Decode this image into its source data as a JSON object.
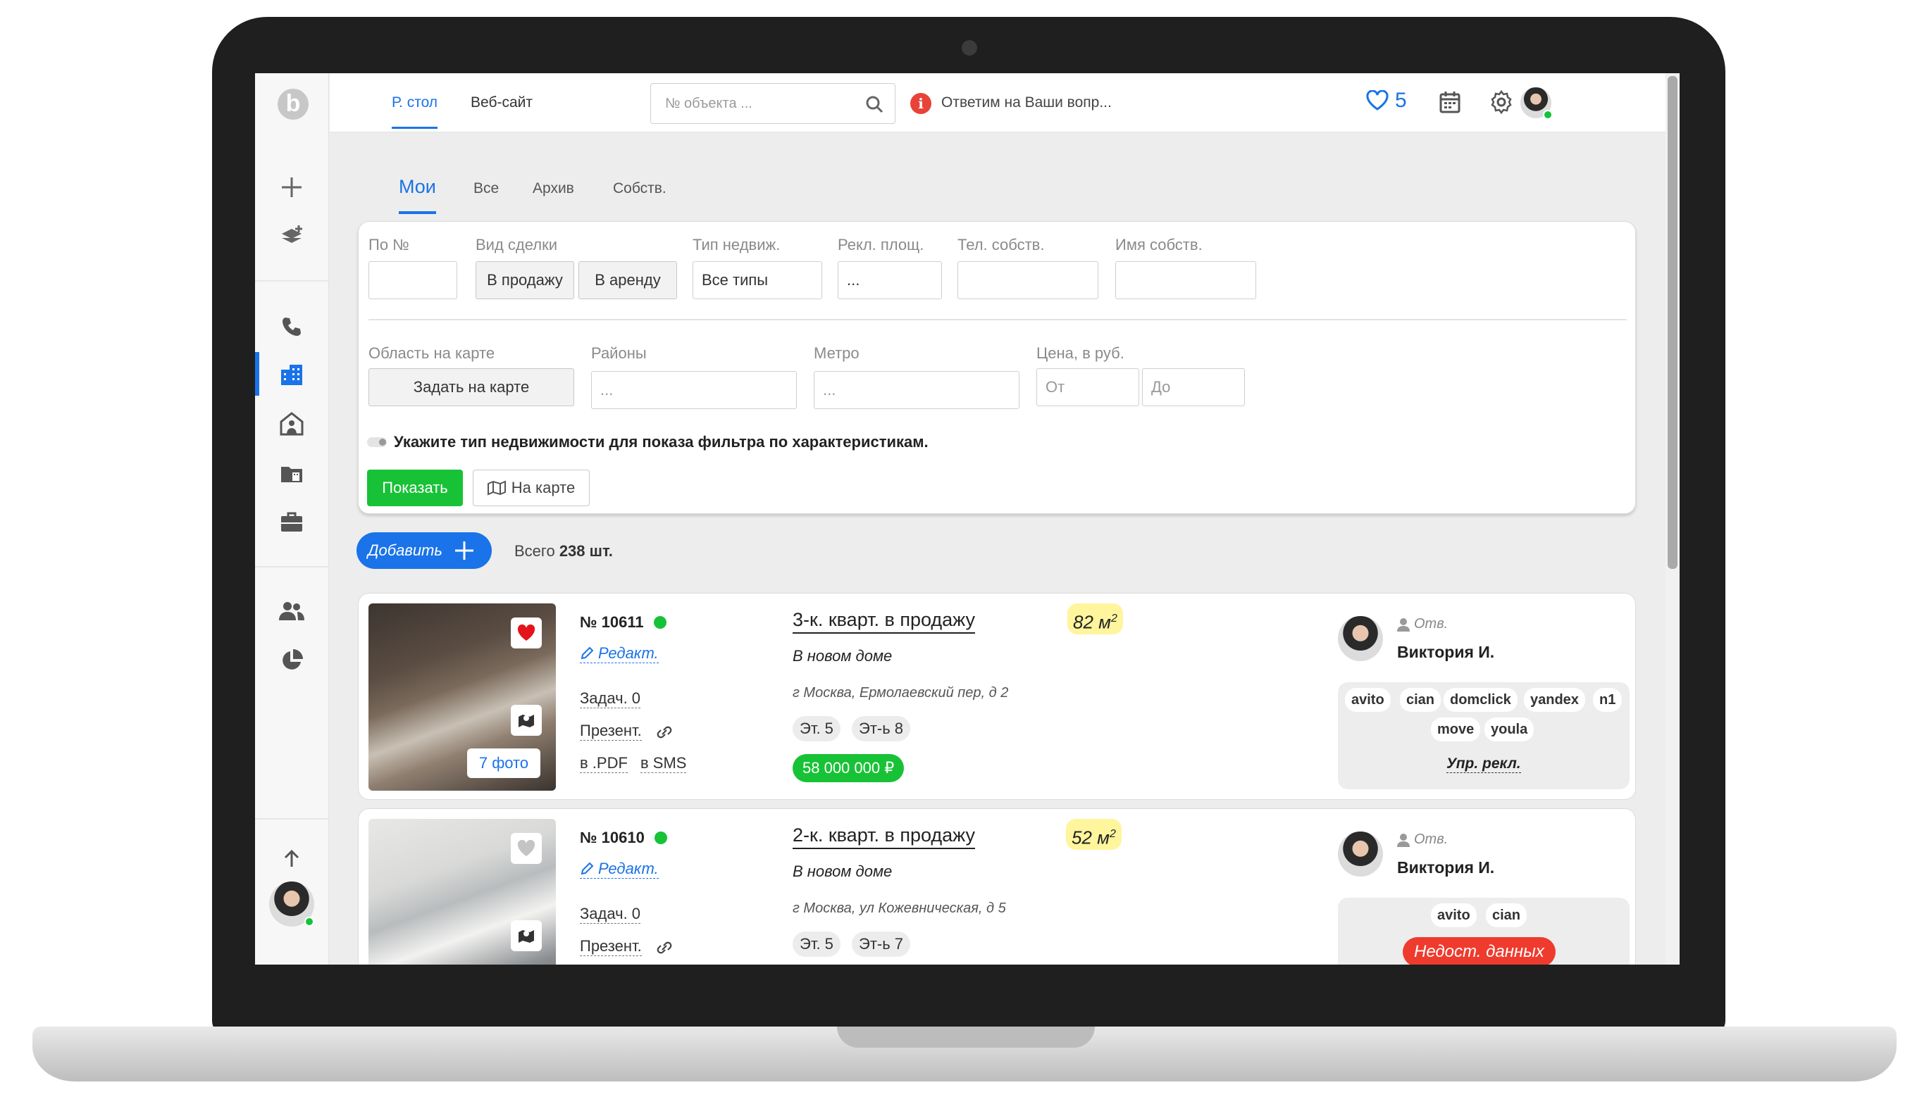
{
  "colors": {
    "accent": "#1a73e8",
    "success": "#18c236",
    "danger": "#ef3b2d",
    "highlight": "#fff59d"
  },
  "topbar": {
    "tabs": [
      {
        "label": "Р. стол",
        "active": true
      },
      {
        "label": "Веб-сайт",
        "active": false
      }
    ],
    "search_placeholder": "№ объекта ...",
    "help_text": "Ответим на Ваши вопр...",
    "favorites_count": "5"
  },
  "sidebar": {
    "logo": "b"
  },
  "subtabs": [
    {
      "label": "Мои",
      "active": true
    },
    {
      "label": "Все"
    },
    {
      "label": "Архив"
    },
    {
      "label": "Собств."
    }
  ],
  "filter": {
    "by_number_label": "По №",
    "deal_type_label": "Вид сделки",
    "deal_sale": "В продажу",
    "deal_rent": "В аренду",
    "property_type_label": "Тип недвиж.",
    "property_type_value": "Все типы",
    "ad_platform_label": "Рекл. площ.",
    "ad_platform_value": "...",
    "owner_phone_label": "Тел. собств.",
    "owner_name_label": "Имя собств.",
    "map_area_label": "Область на карте",
    "map_area_button": "Задать на карте",
    "districts_label": "Районы",
    "districts_placeholder": "...",
    "metro_label": "Метро",
    "metro_placeholder": "...",
    "price_label": "Цена, в руб.",
    "price_from": "От",
    "price_to": "До",
    "hint": "Укажите тип недвижимости для показа фильтра по характеристикам.",
    "show_button": "Показать",
    "map_button": "На карте"
  },
  "list": {
    "add_button": "Добавить",
    "total_prefix": "Всего",
    "total_value": "238 шт."
  },
  "listings": [
    {
      "number": "№ 10611",
      "edit": "Редакт.",
      "tasks": "Задач. 0",
      "presentation": "Презент.",
      "pdf": "в .PDF",
      "sms": "в SMS",
      "photos": "7 фото",
      "favorite": true,
      "title": "3-к. кварт. в продажу",
      "area": "82 м",
      "area_sup": "2",
      "subtitle": "В новом доме",
      "address": "г Москва, Ермолаевский пер, д 2",
      "floor": "Эт. 5",
      "floors": "Эт-ь 8",
      "price": "58 000 000 ₽",
      "responsible_label": "Отв.",
      "responsible_name": "Виктория И.",
      "ads": [
        "avito",
        "cian",
        "domclick",
        "yandex",
        "n1",
        "move",
        "youla"
      ],
      "ads_manage": "Упр. рекл."
    },
    {
      "number": "№ 10610",
      "edit": "Редакт.",
      "tasks": "Задач. 0",
      "presentation": "Презент.",
      "favorite": false,
      "title": "2-к. кварт. в продажу",
      "area": "52 м",
      "area_sup": "2",
      "subtitle": "В новом доме",
      "address": "г Москва, ул Кожевническая, д 5",
      "floor": "Эт. 5",
      "floors": "Эт-ь 7",
      "responsible_label": "Отв.",
      "responsible_name": "Виктория И.",
      "ads": [
        "avito",
        "cian"
      ],
      "ads_warning": "Недост. данных"
    }
  ]
}
